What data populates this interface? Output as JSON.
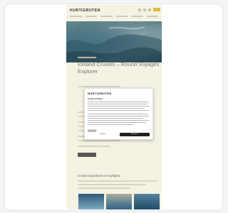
{
  "app": {
    "brand": "HURTIGRUTEN",
    "page_title": "Iceland Cruises – Round Voyages Explorer",
    "section_title": "Iceland Expeditions & Highlights"
  },
  "cookie_dialog": {
    "logo": "HURTIGRUTEN",
    "heading": "Cookies & Privacy",
    "settings_link": "Privacy policy",
    "settings_button": "Settings",
    "accept_button": "Accept all"
  },
  "colors": {
    "page_background": "#fffcee",
    "accent": "#e8c64a",
    "primary_button": "#1f1f1f"
  },
  "icons": [
    "search-icon",
    "user-icon",
    "globe-icon"
  ]
}
